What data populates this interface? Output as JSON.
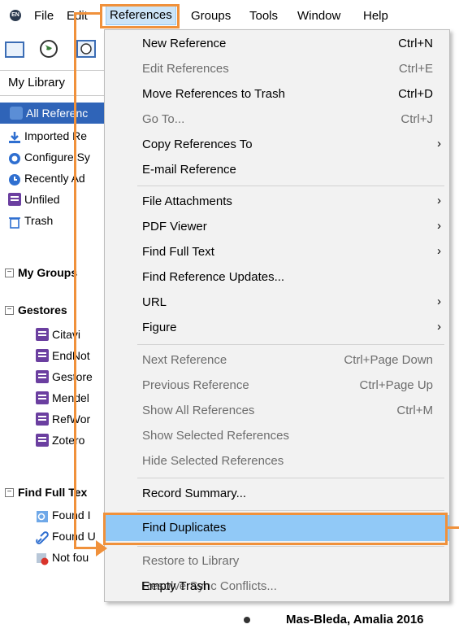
{
  "menubar": {
    "logo": "EN",
    "items": [
      "File",
      "Edit",
      "References",
      "Groups",
      "Tools",
      "Window",
      "Help"
    ]
  },
  "library_header": "My Library",
  "sidebar": {
    "items": [
      {
        "label": "All Referenc",
        "icon": "library-icon"
      },
      {
        "label": "Imported Re",
        "icon": "import-icon"
      },
      {
        "label": "Configure Sy",
        "icon": "sync-icon"
      },
      {
        "label": "Recently Ad",
        "icon": "history-icon"
      },
      {
        "label": "Unfiled",
        "icon": "group-icon"
      },
      {
        "label": "Trash",
        "icon": "trash-icon"
      }
    ],
    "my_groups": "My Groups",
    "gestores": "Gestores",
    "gestores_items": [
      "Citavi",
      "EndNot",
      "Gestore",
      "Mendel",
      "RefWor",
      "Zotero"
    ],
    "find_full_text": "Find Full Tex",
    "fft_items": [
      "Found I",
      "Found U",
      "Not fou"
    ]
  },
  "menu": {
    "items": [
      {
        "label": "New Reference",
        "shortcut": "Ctrl+N"
      },
      {
        "label": "Edit References",
        "shortcut": "Ctrl+E"
      },
      {
        "label": "Move References to Trash",
        "shortcut": "Ctrl+D"
      },
      {
        "label": "Go To...",
        "shortcut": "Ctrl+J"
      },
      {
        "label": "Copy References To"
      },
      {
        "label": "E-mail Reference"
      },
      {
        "label": "File Attachments"
      },
      {
        "label": "PDF Viewer"
      },
      {
        "label": "Find Full Text"
      },
      {
        "label": "Find Reference Updates..."
      },
      {
        "label": "URL"
      },
      {
        "label": "Figure"
      },
      {
        "label": "Next Reference",
        "shortcut": "Ctrl+Page Down"
      },
      {
        "label": "Previous Reference",
        "shortcut": "Ctrl+Page Up"
      },
      {
        "label": "Show All References",
        "shortcut": "Ctrl+M"
      },
      {
        "label": "Show Selected References"
      },
      {
        "label": "Hide Selected References"
      },
      {
        "label": "Record Summary..."
      },
      {
        "label": "Find Duplicates"
      },
      {
        "label": "Restore to Library"
      },
      {
        "label": "Resolve Sync Conflicts..."
      },
      {
        "label": "Empty Trash"
      }
    ]
  },
  "background_row": "Mas-Bleda, Amalia   2016",
  "colors": {
    "accent": "#f0913b",
    "highlight": "#91c9f7",
    "selection": "#2f64b8"
  }
}
